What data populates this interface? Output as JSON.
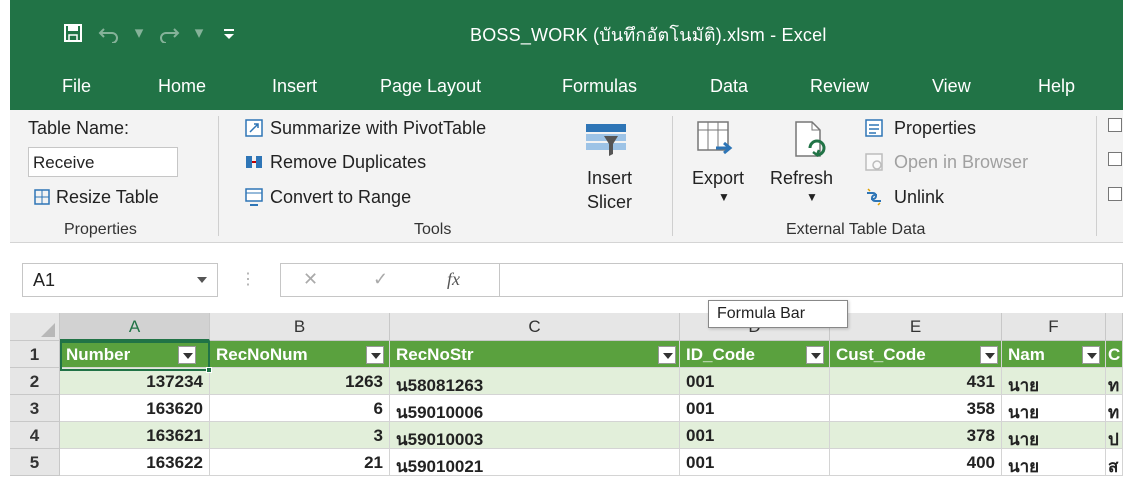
{
  "window": {
    "title": "BOSS_WORK (บันทึกอัตโนมัติ).xlsm  -  Excel",
    "qat": [
      "save-icon",
      "undo-icon",
      "redo-icon",
      "customize-icon"
    ]
  },
  "tabs": [
    "File",
    "Home",
    "Insert",
    "Page Layout",
    "Formulas",
    "Data",
    "Review",
    "View",
    "Help"
  ],
  "ribbon": {
    "properties": {
      "table_name_label": "Table Name:",
      "table_name_value": "Receive",
      "resize_label": "Resize Table",
      "group_label": "Properties"
    },
    "tools": {
      "summarize_label": "Summarize with PivotTable",
      "remove_duplicates_label": "Remove Duplicates",
      "convert_label": "Convert to Range",
      "insert_slicer_line1": "Insert",
      "insert_slicer_line2": "Slicer",
      "group_label": "Tools"
    },
    "external": {
      "export_label": "Export",
      "refresh_label": "Refresh",
      "properties_label": "Properties",
      "open_in_browser_label": "Open in Browser",
      "unlink_label": "Unlink",
      "group_label": "External Table Data"
    }
  },
  "formula_bar": {
    "name_box": "A1",
    "cancel": "✕",
    "enter": "✓",
    "fx": "fx",
    "value": "",
    "tooltip": "Formula Bar"
  },
  "grid": {
    "columns": [
      "A",
      "B",
      "C",
      "D",
      "E",
      "F"
    ],
    "row_numbers": [
      "1",
      "2",
      "3",
      "4",
      "5"
    ],
    "header": [
      "Number",
      "RecNoNum",
      "RecNoStr",
      "ID_Code",
      "Cust_Code",
      "Nam",
      "C"
    ],
    "rows": [
      [
        "137234",
        "1263",
        "น58081263",
        "001",
        "431",
        "นาย",
        "ท"
      ],
      [
        "163620",
        "6",
        "น59010006",
        "001",
        "358",
        "นาย",
        "ท"
      ],
      [
        "163621",
        "3",
        "น59010003",
        "001",
        "378",
        "นาย",
        "ป"
      ],
      [
        "163622",
        "21",
        "น59010021",
        "001",
        "400",
        "นาย",
        "ส"
      ]
    ]
  },
  "colors": {
    "excel_green": "#217346",
    "table_header": "#5aa13e",
    "band_row": "#e2efda"
  }
}
